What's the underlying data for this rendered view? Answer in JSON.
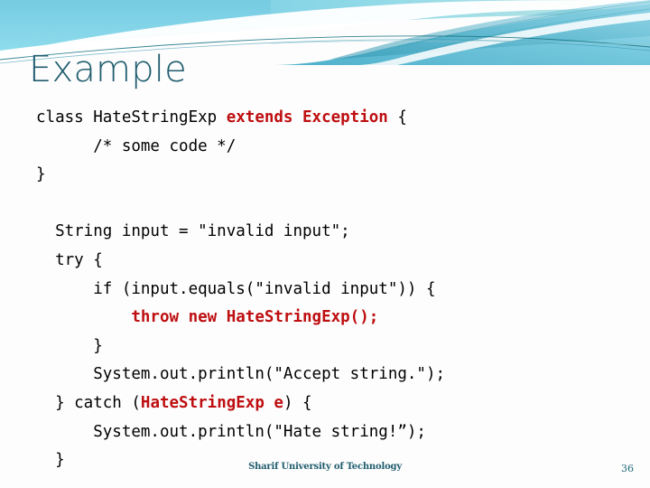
{
  "slide": {
    "title": "Example",
    "footer": "Sharif University of Technology",
    "page_number": "36"
  },
  "theme": {
    "title_color": "#1F5C6E",
    "code_keyword_color": "#BE0E10",
    "code_text_color": "#000000",
    "banner_light": "#8FD6E8",
    "banner_mid": "#5FC3DB",
    "banner_deep": "#2E93AE",
    "banner_line": "#13707F",
    "background": "#FDFDFD",
    "footer_color": "#1F5C6E"
  },
  "code": {
    "lines": [
      {
        "id": "line-class-decl",
        "segments": [
          {
            "text": "class HateStringExp ",
            "style": "plain"
          },
          {
            "text": "extends Exception",
            "style": "red"
          },
          {
            "text": " {",
            "style": "plain"
          }
        ]
      },
      {
        "id": "line-some-code-comment",
        "segments": [
          {
            "text": "      /* some code */",
            "style": "plain"
          }
        ]
      },
      {
        "id": "line-class-close",
        "segments": [
          {
            "text": "}",
            "style": "plain"
          }
        ]
      },
      {
        "id": "line-gap-1",
        "segments": [
          {
            "text": " ",
            "style": "plain"
          }
        ]
      },
      {
        "id": "line-string-input",
        "segments": [
          {
            "text": "  String input = \"invalid input\";",
            "style": "plain"
          }
        ]
      },
      {
        "id": "line-try-open",
        "segments": [
          {
            "text": "  try {",
            "style": "plain"
          }
        ]
      },
      {
        "id": "line-if-equals",
        "segments": [
          {
            "text": "      if (input.equals(\"invalid input\")) {",
            "style": "plain"
          }
        ]
      },
      {
        "id": "line-throw",
        "segments": [
          {
            "text": "          throw new HateStringExp();",
            "style": "red"
          }
        ]
      },
      {
        "id": "line-if-close",
        "segments": [
          {
            "text": "      }",
            "style": "plain"
          }
        ]
      },
      {
        "id": "line-println-accept",
        "segments": [
          {
            "text": "      System.out.println(\"Accept string.\");",
            "style": "plain"
          }
        ]
      },
      {
        "id": "line-catch",
        "segments": [
          {
            "text": "  } catch (",
            "style": "plain"
          },
          {
            "text": "HateStringExp e",
            "style": "red"
          },
          {
            "text": ") {",
            "style": "plain"
          }
        ]
      },
      {
        "id": "line-println-hate",
        "segments": [
          {
            "text": "      System.out.println(\"Hate string!”);",
            "style": "plain"
          }
        ]
      },
      {
        "id": "line-catch-close",
        "segments": [
          {
            "text": "  }",
            "style": "plain"
          }
        ]
      }
    ]
  }
}
